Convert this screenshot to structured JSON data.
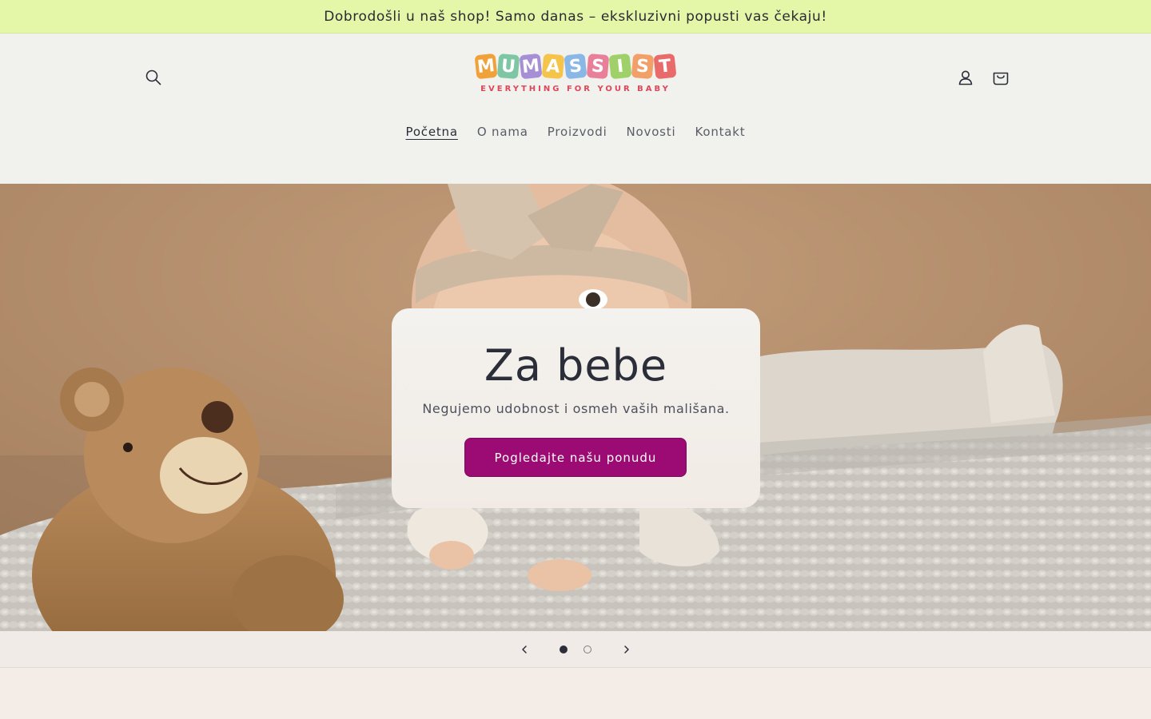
{
  "announcement": {
    "text": "Dobrodošli u naš shop! Samo danas – ekskluzivni popusti vas čekaju!"
  },
  "header": {
    "logo": {
      "letters": [
        {
          "char": "M",
          "color": "#f0a13a"
        },
        {
          "char": "U",
          "color": "#7fc7a4"
        },
        {
          "char": "M",
          "color": "#a68fd4"
        },
        {
          "char": "A",
          "color": "#f4c54a"
        },
        {
          "char": "S",
          "color": "#8ab8e6"
        },
        {
          "char": "S",
          "color": "#e9809a"
        },
        {
          "char": "I",
          "color": "#9fd06a"
        },
        {
          "char": "S",
          "color": "#f2a06a"
        },
        {
          "char": "T",
          "color": "#e86a6a"
        }
      ],
      "tagline": "EVERYTHING FOR YOUR BABY"
    },
    "icons": {
      "search": "search-icon",
      "account": "user-icon",
      "cart": "cart-icon"
    }
  },
  "nav": {
    "items": [
      {
        "label": "Početna",
        "active": true
      },
      {
        "label": "O nama",
        "active": false
      },
      {
        "label": "Proizvodi",
        "active": false
      },
      {
        "label": "Novosti",
        "active": false
      },
      {
        "label": "Kontakt",
        "active": false
      }
    ]
  },
  "hero": {
    "title": "Za bebe",
    "subtitle": "Negujemo udobnost i osmeh vaših mališana.",
    "button_label": "Pogledajte našu ponudu",
    "button_color": "#9c0b73"
  },
  "slider": {
    "current_slide": 1,
    "total_slides": 2,
    "prev_icon": "chevron-left-icon",
    "next_icon": "chevron-right-icon"
  },
  "colors": {
    "announcement_bg": "#e4f7a8",
    "header_bg": "#f1f2ee",
    "page_bg": "#f3ece6"
  }
}
